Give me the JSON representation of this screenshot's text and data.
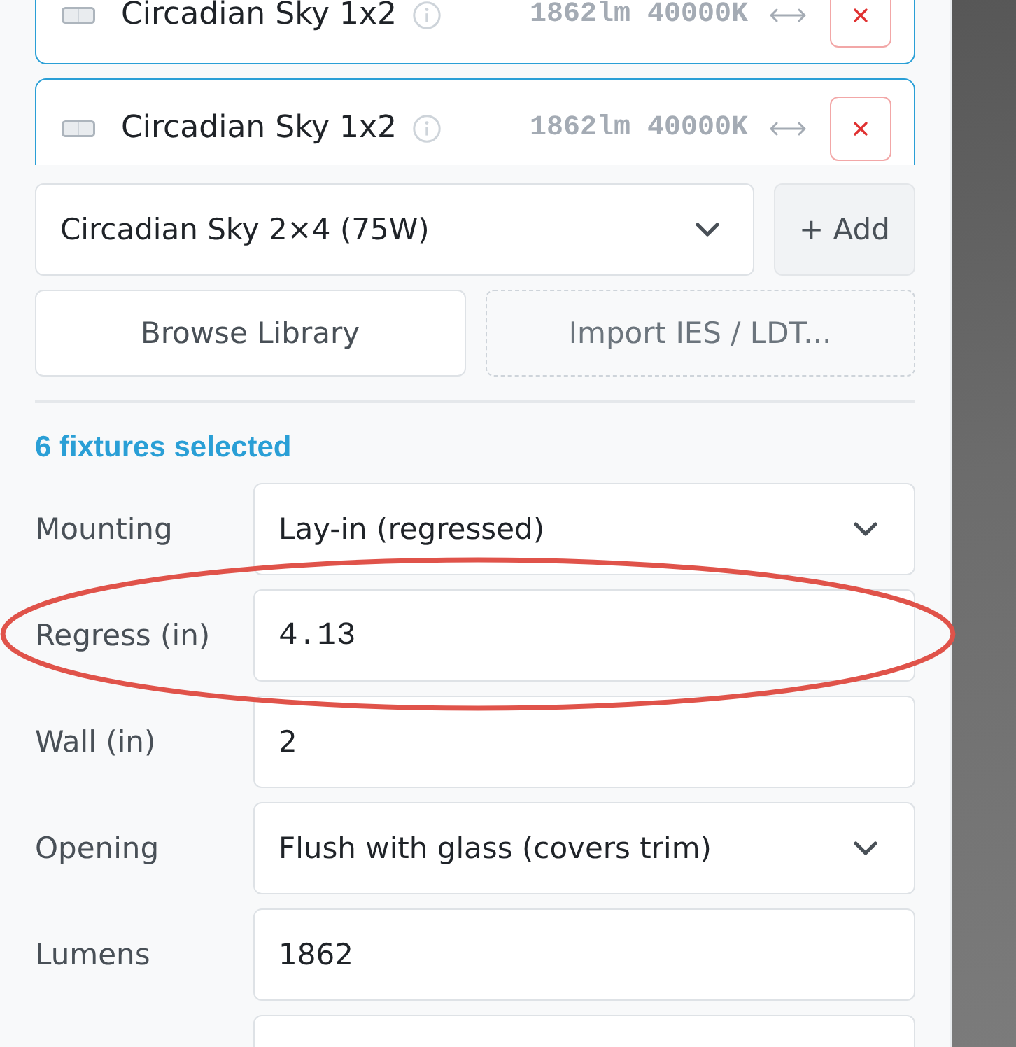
{
  "fixture_list": {
    "items": [
      {
        "name": "Circadian Sky 1x2",
        "specs": "1862lm 40000K",
        "selected": true
      },
      {
        "name": "Circadian Sky 1x2",
        "specs": "1862lm 40000K",
        "selected": true
      }
    ]
  },
  "add_fixture": {
    "select_value": "Circadian Sky 2×4 (75W)",
    "add_button": "+ Add",
    "browse_button": "Browse Library",
    "import_button": "Import IES / LDT..."
  },
  "selection_summary": "6 fixtures selected",
  "properties": [
    {
      "label": "Mounting",
      "kind": "select",
      "value": "Lay-in (regressed)",
      "highlighted": false
    },
    {
      "label": "Regress (in)",
      "kind": "number",
      "value": "4.13",
      "highlighted": true
    },
    {
      "label": "Wall (in)",
      "kind": "text",
      "value": "2",
      "highlighted": false
    },
    {
      "label": "Opening",
      "kind": "select",
      "value": "Flush with glass (covers trim)",
      "highlighted": false
    },
    {
      "label": "Lumens",
      "kind": "text",
      "value": "1862",
      "highlighted": false
    },
    {
      "kind": "text",
      "highlighted": false
    }
  ]
}
